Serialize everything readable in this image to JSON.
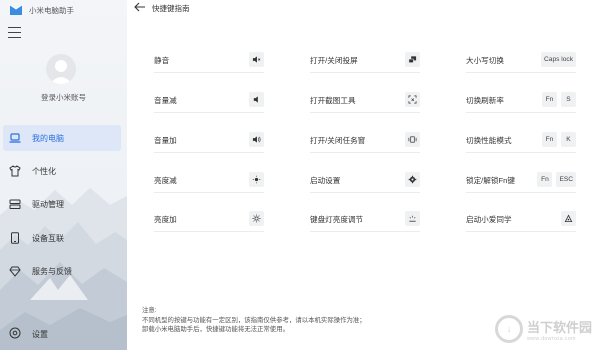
{
  "app": {
    "title": "小米电脑助手",
    "login_text": "登录小米账号"
  },
  "nav": {
    "items": [
      {
        "label": "我的电脑",
        "icon": "laptop-icon",
        "active": true
      },
      {
        "label": "个性化",
        "icon": "tshirt-icon",
        "active": false
      },
      {
        "label": "驱动管理",
        "icon": "driver-icon",
        "active": false
      },
      {
        "label": "设备互联",
        "icon": "tablet-icon",
        "active": false
      },
      {
        "label": "服务与反馈",
        "icon": "diamond-icon",
        "active": false
      }
    ],
    "settings_label": "设置"
  },
  "header": {
    "title": "快捷键指南"
  },
  "shortcuts": [
    {
      "name": "静音",
      "keys": [
        {
          "icon": "mute-icon"
        }
      ]
    },
    {
      "name": "打开/关闭投屏",
      "keys": [
        {
          "icon": "projection-icon"
        }
      ]
    },
    {
      "name": "大小写切换",
      "keys": [
        {
          "text": "Caps lock"
        }
      ]
    },
    {
      "name": "音量减",
      "keys": [
        {
          "icon": "volume-down-icon"
        }
      ]
    },
    {
      "name": "打开截图工具",
      "keys": [
        {
          "icon": "screenshot-icon"
        }
      ]
    },
    {
      "name": "切换刷新率",
      "keys": [
        {
          "text": "Fn"
        },
        {
          "text": "S"
        }
      ]
    },
    {
      "name": "音量加",
      "keys": [
        {
          "icon": "volume-up-icon"
        }
      ]
    },
    {
      "name": "打开/关闭任务窗",
      "keys": [
        {
          "icon": "task-view-icon"
        }
      ]
    },
    {
      "name": "切换性能模式",
      "keys": [
        {
          "text": "Fn"
        },
        {
          "text": "K"
        }
      ]
    },
    {
      "name": "亮度减",
      "keys": [
        {
          "icon": "brightness-down-icon"
        }
      ]
    },
    {
      "name": "启动设置",
      "keys": [
        {
          "icon": "settings-gear-icon"
        }
      ]
    },
    {
      "name": "锁定/解锁Fn键",
      "keys": [
        {
          "text": "Fn"
        },
        {
          "text": "ESC"
        }
      ]
    },
    {
      "name": "亮度加",
      "keys": [
        {
          "icon": "brightness-up-icon"
        }
      ]
    },
    {
      "name": "键盘灯亮度调节",
      "keys": [
        {
          "icon": "keyboard-light-icon"
        }
      ]
    },
    {
      "name": "启动小爱同学",
      "keys": [
        {
          "icon": "xiaoai-icon"
        }
      ]
    }
  ],
  "note": {
    "lines": [
      "注意:",
      "不同机型的按键与功能有一定区别，该指南仅供参考，请以本机实际操作为准；",
      "卸载小米电脑助手后，快捷键功能将无法正常使用。"
    ]
  },
  "watermark": {
    "cn": "当下软件园",
    "en": "www.downxia.com"
  },
  "colors": {
    "accent": "#2d6fe0",
    "active_bg": "#dde7f8",
    "key_bg": "#f0f1f3"
  }
}
